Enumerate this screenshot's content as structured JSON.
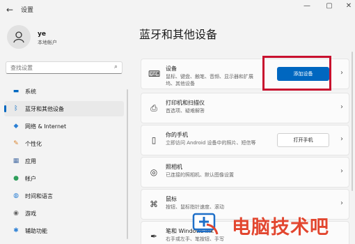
{
  "window": {
    "title": "设置",
    "controls": [
      "—",
      "▢",
      "✕"
    ]
  },
  "user": {
    "name": "ye",
    "account_type": "本地帐户"
  },
  "search": {
    "placeholder": "查找设置"
  },
  "sidebar": {
    "items": [
      {
        "label": "系统",
        "icon": "monitor-icon",
        "active": false
      },
      {
        "label": "蓝牙和其他设备",
        "icon": "bluetooth-icon",
        "active": true
      },
      {
        "label": "网络 & Internet",
        "icon": "wifi-icon",
        "active": false
      },
      {
        "label": "个性化",
        "icon": "brush-icon",
        "active": false
      },
      {
        "label": "应用",
        "icon": "apps-icon",
        "active": false
      },
      {
        "label": "帐户",
        "icon": "person-icon",
        "active": false
      },
      {
        "label": "时间和语言",
        "icon": "globe-icon",
        "active": false
      },
      {
        "label": "游戏",
        "icon": "gamepad-icon",
        "active": false
      },
      {
        "label": "辅助功能",
        "icon": "accessibility-icon",
        "active": false
      }
    ]
  },
  "main": {
    "title": "蓝牙和其他设备",
    "cards": [
      {
        "title": "设备",
        "desc": "鼠标、键盘、触笔、音频、显示器和扩展坞、其他设备",
        "icon": "devices-icon",
        "button": "添加设备"
      },
      {
        "title": "打印机和扫描仪",
        "desc": "首选项、疑难解答",
        "icon": "printer-icon"
      },
      {
        "title": "你的手机",
        "desc": "立即访问 Android 设备中的照片、短信等",
        "icon": "phone-icon",
        "button": "打开手机"
      },
      {
        "title": "照相机",
        "desc": "已连接的照相机、默认图像设置",
        "icon": "camera-icon"
      },
      {
        "title": "鼠标",
        "desc": "按钮、鼠标指针速度、滚动",
        "icon": "mouse-icon"
      },
      {
        "title": "笔和 Windows Ink",
        "desc": "右手或左手、笔按钮、手写",
        "icon": "pen-icon"
      }
    ]
  },
  "watermark": {
    "text": "电脑技术吧"
  },
  "colors": {
    "accent": "#0067c0",
    "highlight_box": "#c8102e",
    "watermark": "#e2462f"
  }
}
